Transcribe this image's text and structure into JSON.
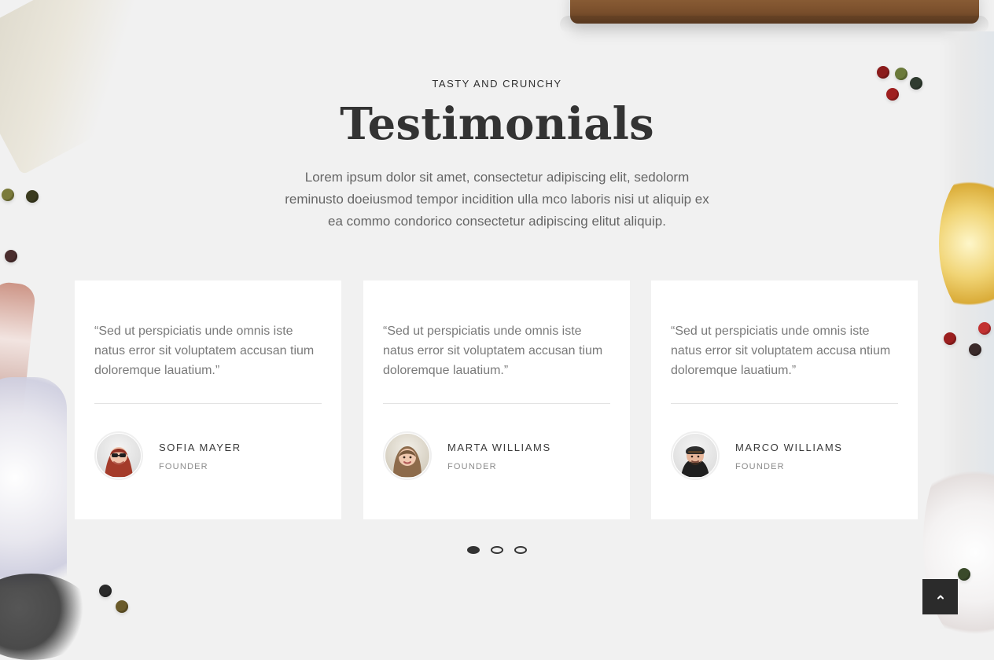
{
  "header": {
    "eyebrow": "TASTY AND CRUNCHY",
    "title": "Testimonials",
    "lead": "Lorem ipsum dolor sit amet, consectetur adipiscing elit, sedolorm reminusto doeiusmod tempor incidition ulla mco laboris nisi ut aliquip ex ea commo condorico consectetur adipiscing elitut aliquip."
  },
  "testimonials": [
    {
      "quote": "“Sed ut perspiciatis unde omnis iste natus error sit voluptatem accusan tium doloremque lauatium.”",
      "name": "SOFIA MAYER",
      "role": "FOUNDER",
      "avatar_icon": "woman-with-sunglasses-avatar"
    },
    {
      "quote": "“Sed ut perspiciatis unde omnis iste natus error sit voluptatem accusan tium doloremque lauatium.”",
      "name": "MARTA WILLIAMS",
      "role": "FOUNDER",
      "avatar_icon": "woman-long-hair-avatar"
    },
    {
      "quote": "“Sed ut perspiciatis unde omnis iste natus error sit voluptatem accusa ntium doloremque lauatium.”",
      "name": "MARCO WILLIAMS",
      "role": "FOUNDER",
      "avatar_icon": "man-with-hat-avatar"
    }
  ],
  "pagination": {
    "active_index": 0,
    "count": 3
  },
  "back_to_top": {
    "icon": "chevron-up-icon"
  },
  "colors": {
    "background": "#f1f1f1",
    "card": "#ffffff",
    "text_dark": "#333333",
    "text_muted": "#7a7a7a",
    "dot": "#333333",
    "back_to_top": "#2b2b2b"
  }
}
